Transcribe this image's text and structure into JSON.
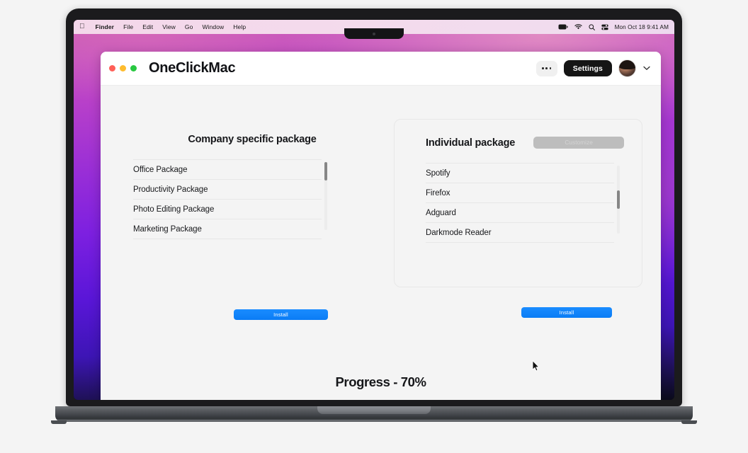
{
  "menubar": {
    "apple_icon": "apple-logo-icon",
    "items": [
      {
        "label": "Finder",
        "bold": true
      },
      {
        "label": "File",
        "bold": false
      },
      {
        "label": "Edit",
        "bold": false
      },
      {
        "label": "View",
        "bold": false
      },
      {
        "label": "Go",
        "bold": false
      },
      {
        "label": "Window",
        "bold": false
      },
      {
        "label": "Help",
        "bold": false
      }
    ],
    "status_icons": [
      "battery-icon",
      "wifi-icon",
      "search-icon",
      "control-center-icon"
    ],
    "clock": "Mon Oct 18  9:41 AM"
  },
  "window": {
    "title": "OneClickMac",
    "traffic_lights": [
      "close-button",
      "minimize-button",
      "maximize-button"
    ],
    "more_label": "",
    "settings_label": "Settings",
    "avatar_name": "user-avatar",
    "chevron": "chevron-down-icon"
  },
  "company_panel": {
    "title": "Company specific package",
    "items": [
      "Office Package",
      "Productivity Package",
      "Photo Editing Package",
      "Marketing Package"
    ],
    "install_label": "Install"
  },
  "individual_panel": {
    "title": "Individual package",
    "customize_label": "Customize",
    "items": [
      "Spotify",
      "Firefox",
      "Adguard",
      "Darkmode Reader"
    ],
    "install_label": "Install"
  },
  "progress": {
    "label": "Progress - 70%",
    "percent": 70
  },
  "colors": {
    "accent_blue": "#0a7cf5",
    "settings_dark": "#151515",
    "customize_gray": "#bdbdbd",
    "panel_bg": "#f4f4f4"
  }
}
